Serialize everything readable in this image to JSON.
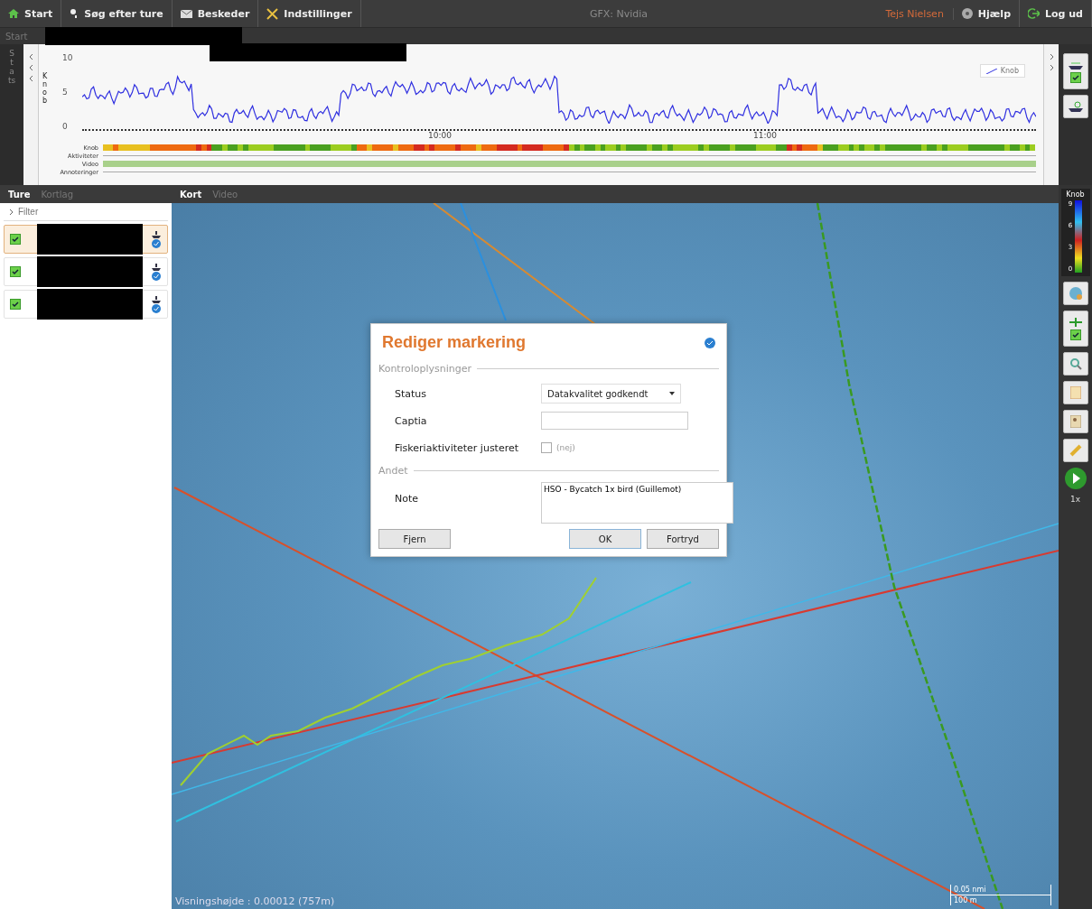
{
  "menu": [
    {
      "label": "Start"
    },
    {
      "label": "Søg efter ture"
    },
    {
      "label": "Beskeder"
    },
    {
      "label": "Indstillinger"
    }
  ],
  "gfx": "GFX: Nvidia",
  "user": "Tejs Nielsen",
  "right_menu": [
    {
      "label": "Hjælp"
    },
    {
      "label": "Log ud"
    }
  ],
  "chart_tools": [
    {
      "checked": true
    }
  ],
  "map_tools": [
    {
      "checked": true
    }
  ],
  "breadcrumb": "Start",
  "side_tab": "Stats",
  "chart": {
    "ylabel": "Knob",
    "yticks": [
      "10",
      "5",
      "0"
    ],
    "xticks": [
      "10:00",
      "11:00"
    ],
    "legend": "Knob",
    "tracks": [
      "Knob",
      "Aktiviteter",
      "Video",
      "Annoteringer"
    ]
  },
  "left_tabs": [
    {
      "label": "Ture",
      "selected": true
    },
    {
      "label": "Kortlag",
      "selected": false
    }
  ],
  "filter": "Filter",
  "trips": [
    {
      "checked": true,
      "selected": true
    },
    {
      "checked": true,
      "selected": false
    },
    {
      "checked": true,
      "selected": false
    }
  ],
  "map_tabs": [
    {
      "label": "Kort",
      "selected": true
    },
    {
      "label": "Video",
      "selected": false
    }
  ],
  "legend": {
    "title": "Knob",
    "ticks": [
      "9",
      "6",
      "3",
      "0"
    ]
  },
  "speed": "1x",
  "map_status": "Visningshøjde : 0.00012 (757m)",
  "scale": [
    "0.05 nmi",
    "100 m"
  ],
  "dialog": {
    "title": "Rediger markering",
    "sections": [
      {
        "title": "Kontroloplysninger",
        "fields": [
          {
            "kind": "select",
            "label": "Status",
            "value": "Datakvalitet godkendt"
          },
          {
            "kind": "text",
            "label": "Captia"
          },
          {
            "kind": "checkbox",
            "label": "Fiskeriaktiviteter justeret",
            "checked": false,
            "text": "(nej)"
          }
        ]
      },
      {
        "title": "Andet",
        "fields": [
          {
            "kind": "textarea",
            "label": "Note",
            "value": "HSO - Bycatch 1x bird (Guillemot)"
          }
        ]
      }
    ],
    "buttons": [
      {
        "label": "Fjern"
      },
      {
        "label": "OK"
      },
      {
        "label": "Fortryd"
      }
    ]
  }
}
